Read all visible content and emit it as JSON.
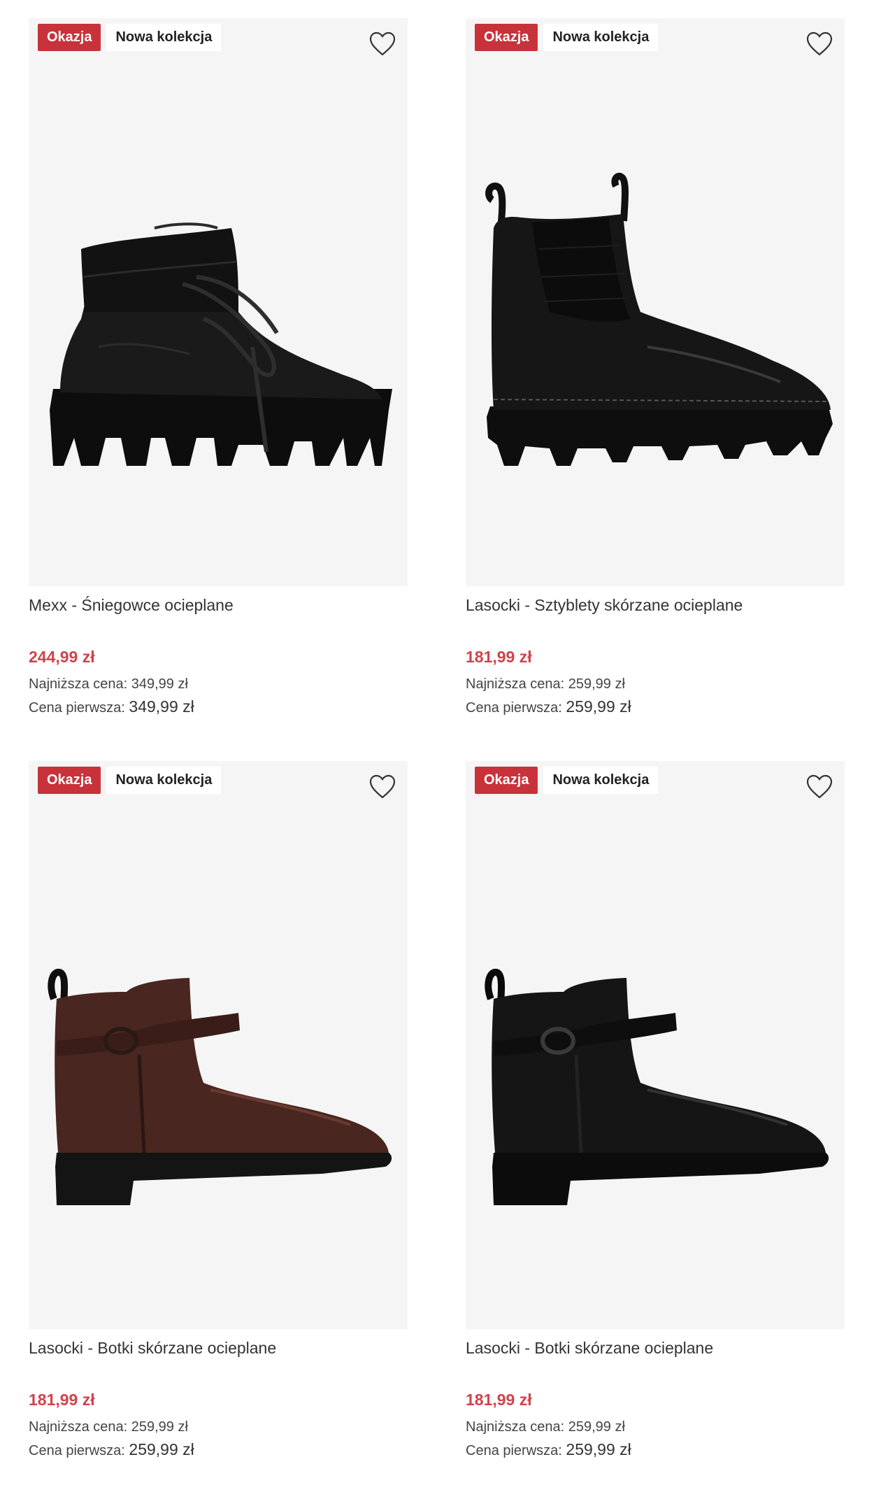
{
  "products": [
    {
      "badge_sale": "Okazja",
      "badge_new": "Nowa kolekcja",
      "name": "Mexx - Śniegowce ocieplane",
      "price": "244,99 zł",
      "lowest_price_label": "Najniższa cena:",
      "lowest_price_value": "349,99 zł",
      "first_price_label": "Cena pierwsza:",
      "first_price_value": "349,99 zł",
      "image_icon": "black-snow-boot",
      "boot_color": "#111111"
    },
    {
      "badge_sale": "Okazja",
      "badge_new": "Nowa kolekcja",
      "name": "Lasocki - Sztyblety skórzane ocieplane",
      "price": "181,99 zł",
      "lowest_price_label": "Najniższa cena:",
      "lowest_price_value": "259,99 zł",
      "first_price_label": "Cena pierwsza:",
      "first_price_value": "259,99 zł",
      "image_icon": "black-chelsea-boot",
      "boot_color": "#141414"
    },
    {
      "badge_sale": "Okazja",
      "badge_new": "Nowa kolekcja",
      "name": "Lasocki - Botki skórzane ocieplane",
      "price": "181,99 zł",
      "lowest_price_label": "Najniższa cena:",
      "lowest_price_value": "259,99 zł",
      "first_price_label": "Cena pierwsza:",
      "first_price_value": "259,99 zł",
      "image_icon": "brown-ankle-boot",
      "boot_color": "#4a2620"
    },
    {
      "badge_sale": "Okazja",
      "badge_new": "Nowa kolekcja",
      "name": "Lasocki - Botki skórzane ocieplane",
      "price": "181,99 zł",
      "lowest_price_label": "Najniższa cena:",
      "lowest_price_value": "259,99 zł",
      "first_price_label": "Cena pierwsza:",
      "first_price_value": "259,99 zł",
      "image_icon": "black-ankle-boot",
      "boot_color": "#151515"
    }
  ],
  "icons": {
    "wishlist": "heart-outline-icon"
  },
  "colors": {
    "sale_badge": "#c8323a",
    "price": "#d0434b",
    "image_bg": "#f5f5f5"
  }
}
